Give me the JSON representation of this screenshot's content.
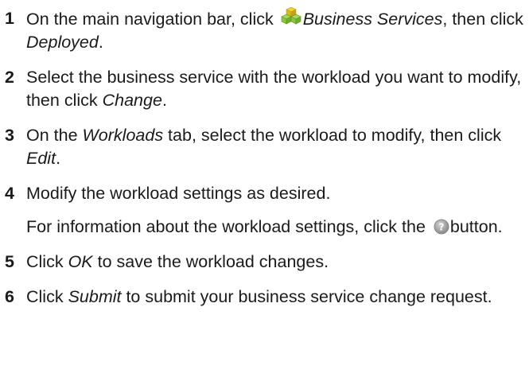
{
  "steps": [
    {
      "number": "1",
      "parts": {
        "a": "On the main navigation bar, click ",
        "b": "Business Services",
        "c": ", then click ",
        "d": "Deployed",
        "e": "."
      },
      "icon": "business-services-icon"
    },
    {
      "number": "2",
      "parts": {
        "a": "Select the business service with the workload you want to modify, then click ",
        "b": "Change",
        "c": "."
      }
    },
    {
      "number": "3",
      "parts": {
        "a": "On the ",
        "b": "Workloads",
        "c": " tab, select the workload to modify, then click ",
        "d": "Edit",
        "e": "."
      }
    },
    {
      "number": "4",
      "parts": {
        "a": "Modify the workload settings as desired."
      }
    },
    {
      "number": "",
      "parts": {
        "a": "For information about the workload settings, click the ",
        "b": "button."
      },
      "icon": "help-icon"
    },
    {
      "number": "5",
      "parts": {
        "a": "Click ",
        "b": "OK",
        "c": " to save the workload changes."
      }
    },
    {
      "number": "6",
      "parts": {
        "a": "Click ",
        "b": "Submit",
        "c": " to submit your business service change request."
      }
    }
  ],
  "colors": {
    "text": "#1a1a1a",
    "icon_green": "#8cc63f",
    "icon_yellow": "#f2d22e",
    "help_gray": "#9a9a9a"
  }
}
